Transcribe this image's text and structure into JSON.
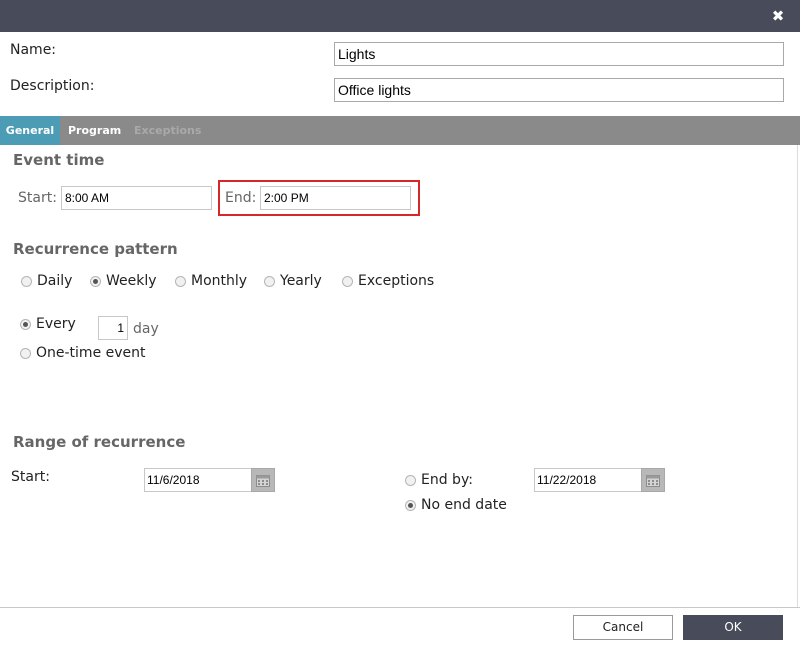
{
  "form": {
    "name_label": "Name:",
    "name_value": "Lights",
    "description_label": "Description:",
    "description_value": "Office lights"
  },
  "tabs": [
    {
      "label": "General",
      "state": "active"
    },
    {
      "label": "Program",
      "state": "normal"
    },
    {
      "label": "Exceptions",
      "state": "disabled"
    }
  ],
  "event_time": {
    "title": "Event time",
    "start_label": "Start:",
    "start_value": "8:00 AM",
    "end_label": "End:",
    "end_value": "2:00 PM"
  },
  "recurrence": {
    "title": "Recurrence pattern",
    "options": [
      {
        "label": "Daily",
        "checked": false
      },
      {
        "label": "Weekly",
        "checked": true
      },
      {
        "label": "Monthly",
        "checked": false
      },
      {
        "label": "Yearly",
        "checked": false
      },
      {
        "label": "Exceptions",
        "checked": false
      }
    ],
    "every_label": "Every",
    "every_value": "1",
    "day_label": "day",
    "one_time_label": "One-time event"
  },
  "range": {
    "title": "Range of recurrence",
    "start_label": "Start:",
    "start_date": "11/6/2018",
    "end_by_label": "End by:",
    "end_date": "11/22/2018",
    "no_end_label": "No end date"
  },
  "footer": {
    "cancel_label": "Cancel",
    "ok_label": "OK"
  },
  "colors": {
    "titlebar": "#484b5a",
    "tab_active": "#4c9cb6",
    "tabbar": "#8a8a8a",
    "highlight": "#d62828"
  },
  "icons": {
    "close": "close-icon",
    "calendar": "calendar-icon"
  }
}
